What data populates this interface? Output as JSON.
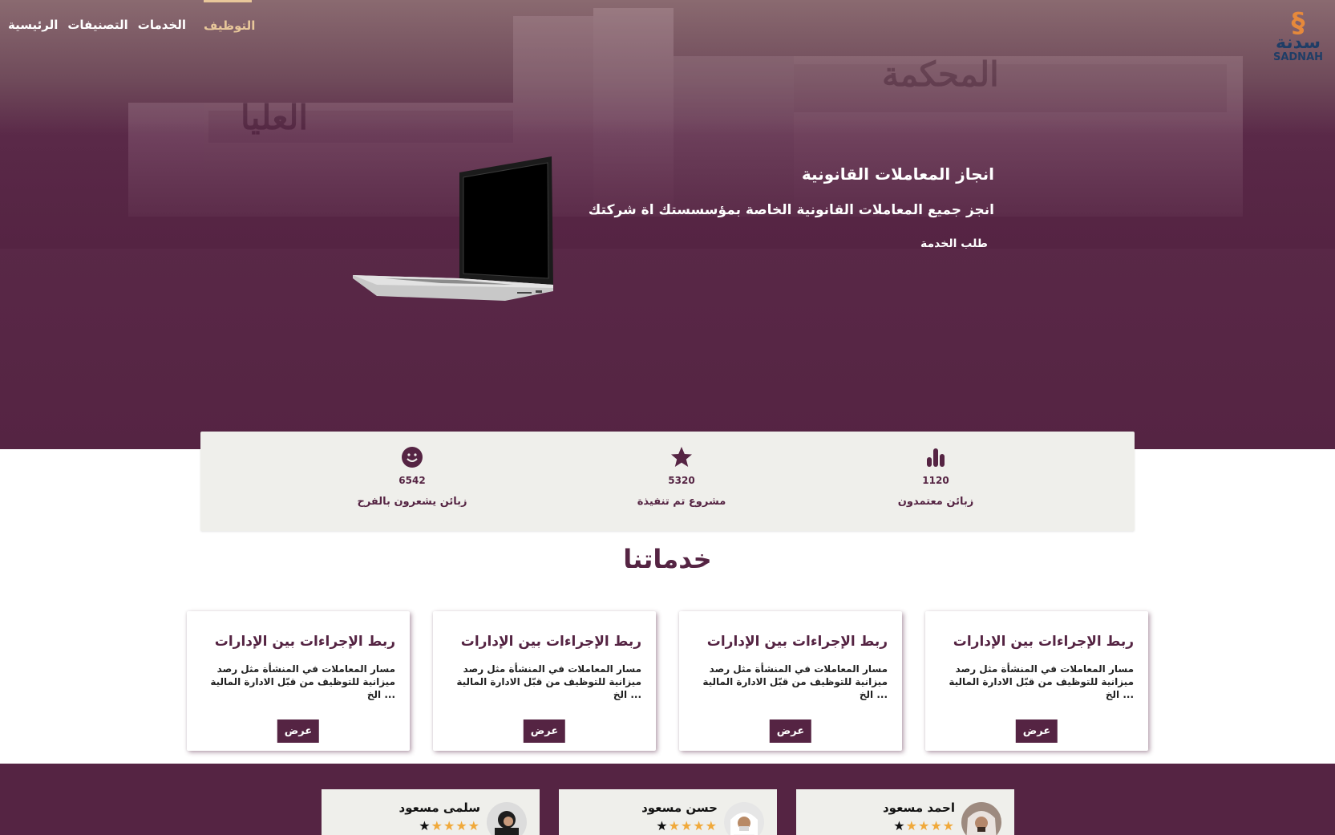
{
  "nav": {
    "items": [
      {
        "label": "الرئيسية",
        "active": false
      },
      {
        "label": "التصنيفات",
        "active": false
      },
      {
        "label": "الخدمات",
        "active": false
      },
      {
        "label": "التوظيف",
        "active": true
      }
    ]
  },
  "logo": {
    "arabic": "سدنة",
    "latin": "SADNAH"
  },
  "hero": {
    "background_text_left": "العليا",
    "background_text_right": "المحكمة",
    "title": "انجاز المعاملات القانونية",
    "subtitle": "انجز جميع المعاملات القانونية الخاصة بمؤسسستك اة شركتك",
    "cta": "طلب الخدمة"
  },
  "stats": [
    {
      "icon": "smiley-icon",
      "value": "6542",
      "label": "زبائن يشعرون بالفرح"
    },
    {
      "icon": "star-icon",
      "value": "5320",
      "label": "مشروع تم تنفيذة"
    },
    {
      "icon": "bar-chart-icon",
      "value": "1120",
      "label": "زبائن معتمدون"
    }
  ],
  "services": {
    "title": "خدماتنا",
    "cards": [
      {
        "title": "ربط الإجراءات بين الإدارات",
        "description": "مسار المعاملات في المنشأة مثل رصد ميزانية للتوظيف من قبّل الادارة المالية ... الخ",
        "button": "عرض"
      },
      {
        "title": "ربط الإجراءات بين الإدارات",
        "description": "مسار المعاملات في المنشأة مثل رصد ميزانية للتوظيف من قبّل الادارة المالية ... الخ",
        "button": "عرض"
      },
      {
        "title": "ربط الإجراءات بين الإدارات",
        "description": "مسار المعاملات في المنشأة مثل رصد ميزانية للتوظيف من قبّل الادارة المالية ... الخ",
        "button": "عرض"
      },
      {
        "title": "ربط الإجراءات بين الإدارات",
        "description": "مسار المعاملات في المنشأة مثل رصد ميزانية للتوظيف من قبّل الادارة المالية ... الخ",
        "button": "عرض"
      }
    ]
  },
  "testimonials": [
    {
      "name": "سلمى مسعود",
      "rating": 4,
      "max_rating": 5
    },
    {
      "name": "حسن مسعود",
      "rating": 4,
      "max_rating": 5
    },
    {
      "name": "احمد مسعود",
      "rating": 4,
      "max_rating": 5
    }
  ],
  "colors": {
    "brand": "#552443",
    "accent": "#e8c79a",
    "star": "#f0a93a",
    "logo_orange": "#e6893b",
    "logo_blue": "#1f3d66"
  }
}
